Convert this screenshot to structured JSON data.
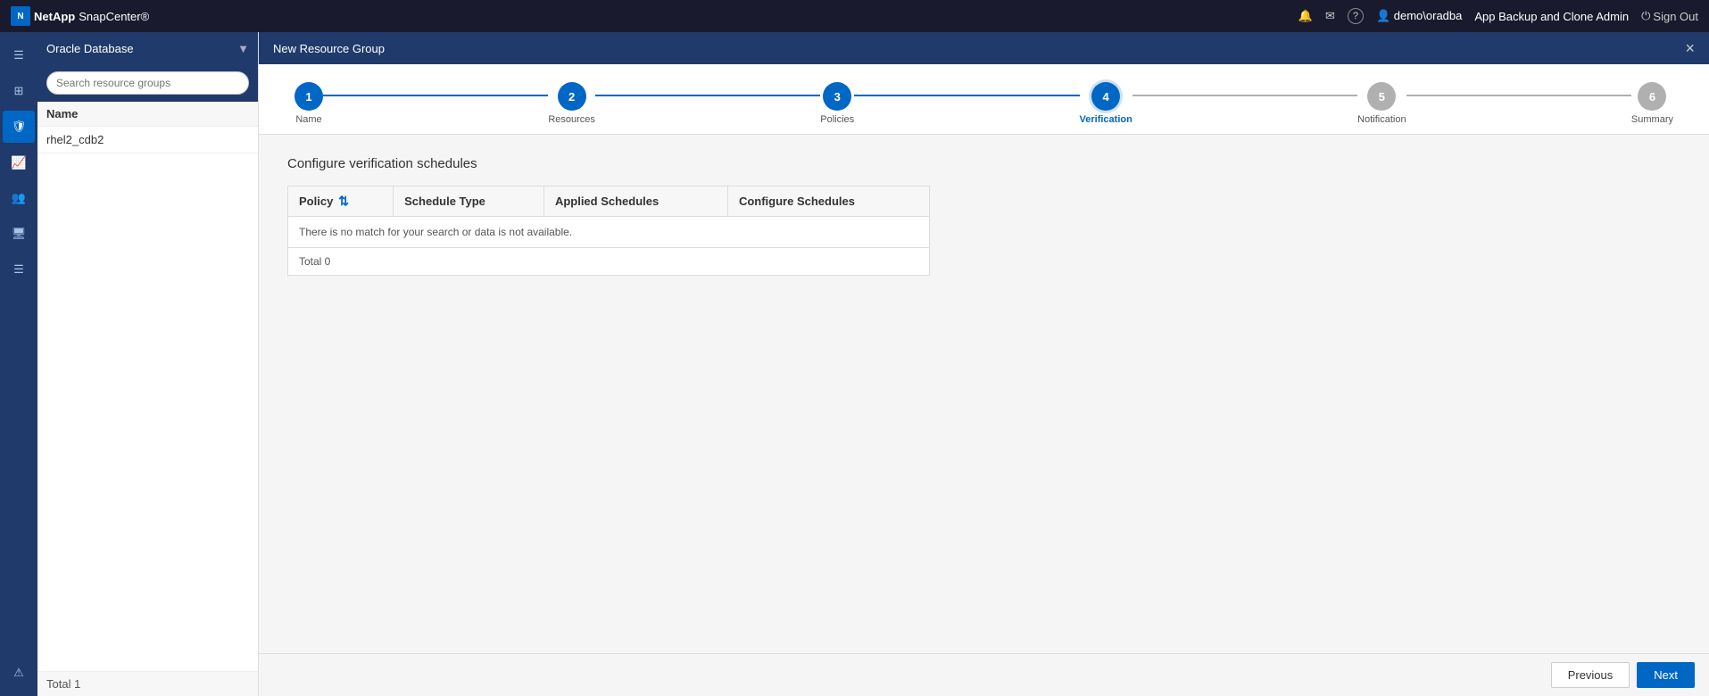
{
  "navbar": {
    "brand": "NetApp",
    "app_name": "SnapCenter®",
    "icons": [
      "bell",
      "mail",
      "help"
    ],
    "user": "demo\\oradba",
    "role": "App Backup and Clone Admin",
    "signout": "Sign Out"
  },
  "sidebar": {
    "module_title": "Oracle Database",
    "search_placeholder": "Search resource groups",
    "table_header": "Name",
    "items": [
      "rhel2_cdb2"
    ],
    "footer": "Total 1"
  },
  "content": {
    "header_title": "New Resource Group",
    "close_label": "×",
    "wizard": {
      "steps": [
        {
          "number": "1",
          "label": "Name",
          "state": "done"
        },
        {
          "number": "2",
          "label": "Resources",
          "state": "done"
        },
        {
          "number": "3",
          "label": "Policies",
          "state": "done"
        },
        {
          "number": "4",
          "label": "Verification",
          "state": "active"
        },
        {
          "number": "5",
          "label": "Notification",
          "state": "inactive"
        },
        {
          "number": "6",
          "label": "Summary",
          "state": "inactive"
        }
      ]
    },
    "section_title": "Configure verification schedules",
    "table": {
      "columns": [
        "Policy",
        "Schedule Type",
        "Applied Schedules",
        "Configure Schedules"
      ],
      "empty_message": "There is no match for your search or data is not available.",
      "footer": "Total 0"
    },
    "buttons": {
      "previous": "Previous",
      "next": "Next"
    }
  },
  "icons": {
    "menu": "☰",
    "apps": "⊞",
    "shield": "🛡",
    "chart": "📊",
    "users": "👥",
    "server": "🖥",
    "list": "☰",
    "warning": "⚠",
    "bell": "🔔",
    "mail": "✉",
    "help": "?",
    "user": "👤",
    "signout": "⏻",
    "dropdown": "▼",
    "sort": "⇅"
  }
}
